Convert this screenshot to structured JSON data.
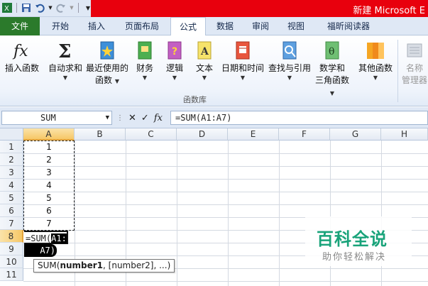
{
  "window": {
    "title": "新建 Microsoft E"
  },
  "tabs": [
    "文件",
    "开始",
    "插入",
    "页面布局",
    "公式",
    "数据",
    "审阅",
    "视图",
    "福昕阅读器"
  ],
  "active_tab": "公式",
  "ribbon": {
    "buttons": [
      {
        "label": "插入函数",
        "icon": "fx-icon"
      },
      {
        "label": "自动求和",
        "icon": "sigma-icon"
      },
      {
        "label": "最近使用的",
        "label2": "函数",
        "icon": "star-book-icon"
      },
      {
        "label": "财务",
        "icon": "finance-book-icon"
      },
      {
        "label": "逻辑",
        "icon": "logic-book-icon"
      },
      {
        "label": "文本",
        "icon": "text-book-icon"
      },
      {
        "label": "日期和时间",
        "icon": "calendar-book-icon"
      },
      {
        "label": "查找与引用",
        "icon": "magnifier-book-icon"
      },
      {
        "label": "数学和",
        "label2": "三角函数",
        "icon": "theta-book-icon"
      },
      {
        "label": "其他函数",
        "icon": "more-books-icon"
      },
      {
        "label": "名称",
        "label2": "管理器",
        "icon": "name-manager-icon"
      }
    ],
    "group_label": "函数库"
  },
  "formula_bar": {
    "name_box": "SUM",
    "cancel": "✕",
    "enter": "✓",
    "fx": "fx",
    "formula": "=SUM(A1:A7)"
  },
  "columns": [
    "A",
    "B",
    "C",
    "D",
    "E",
    "F",
    "G",
    "H"
  ],
  "rows": [
    "1",
    "2",
    "3",
    "4",
    "5",
    "6",
    "7",
    "8",
    "9",
    "10",
    "11"
  ],
  "cells_a": [
    "1",
    "2",
    "3",
    "4",
    "5",
    "6",
    "7"
  ],
  "edit": {
    "prefix": "=SUM(",
    "ref1": "A1:",
    "ref2": "A7",
    "close": ")"
  },
  "tooltip": {
    "fn": "SUM(",
    "arg1": "number1",
    "rest": ", [number2], ...)"
  },
  "watermark": {
    "title": "百科全说",
    "subtitle": "助你轻松解决"
  },
  "colors": {
    "accent_red": "#e8000d",
    "file_tab": "#2b7a2b",
    "watermark": "#19a37a"
  }
}
